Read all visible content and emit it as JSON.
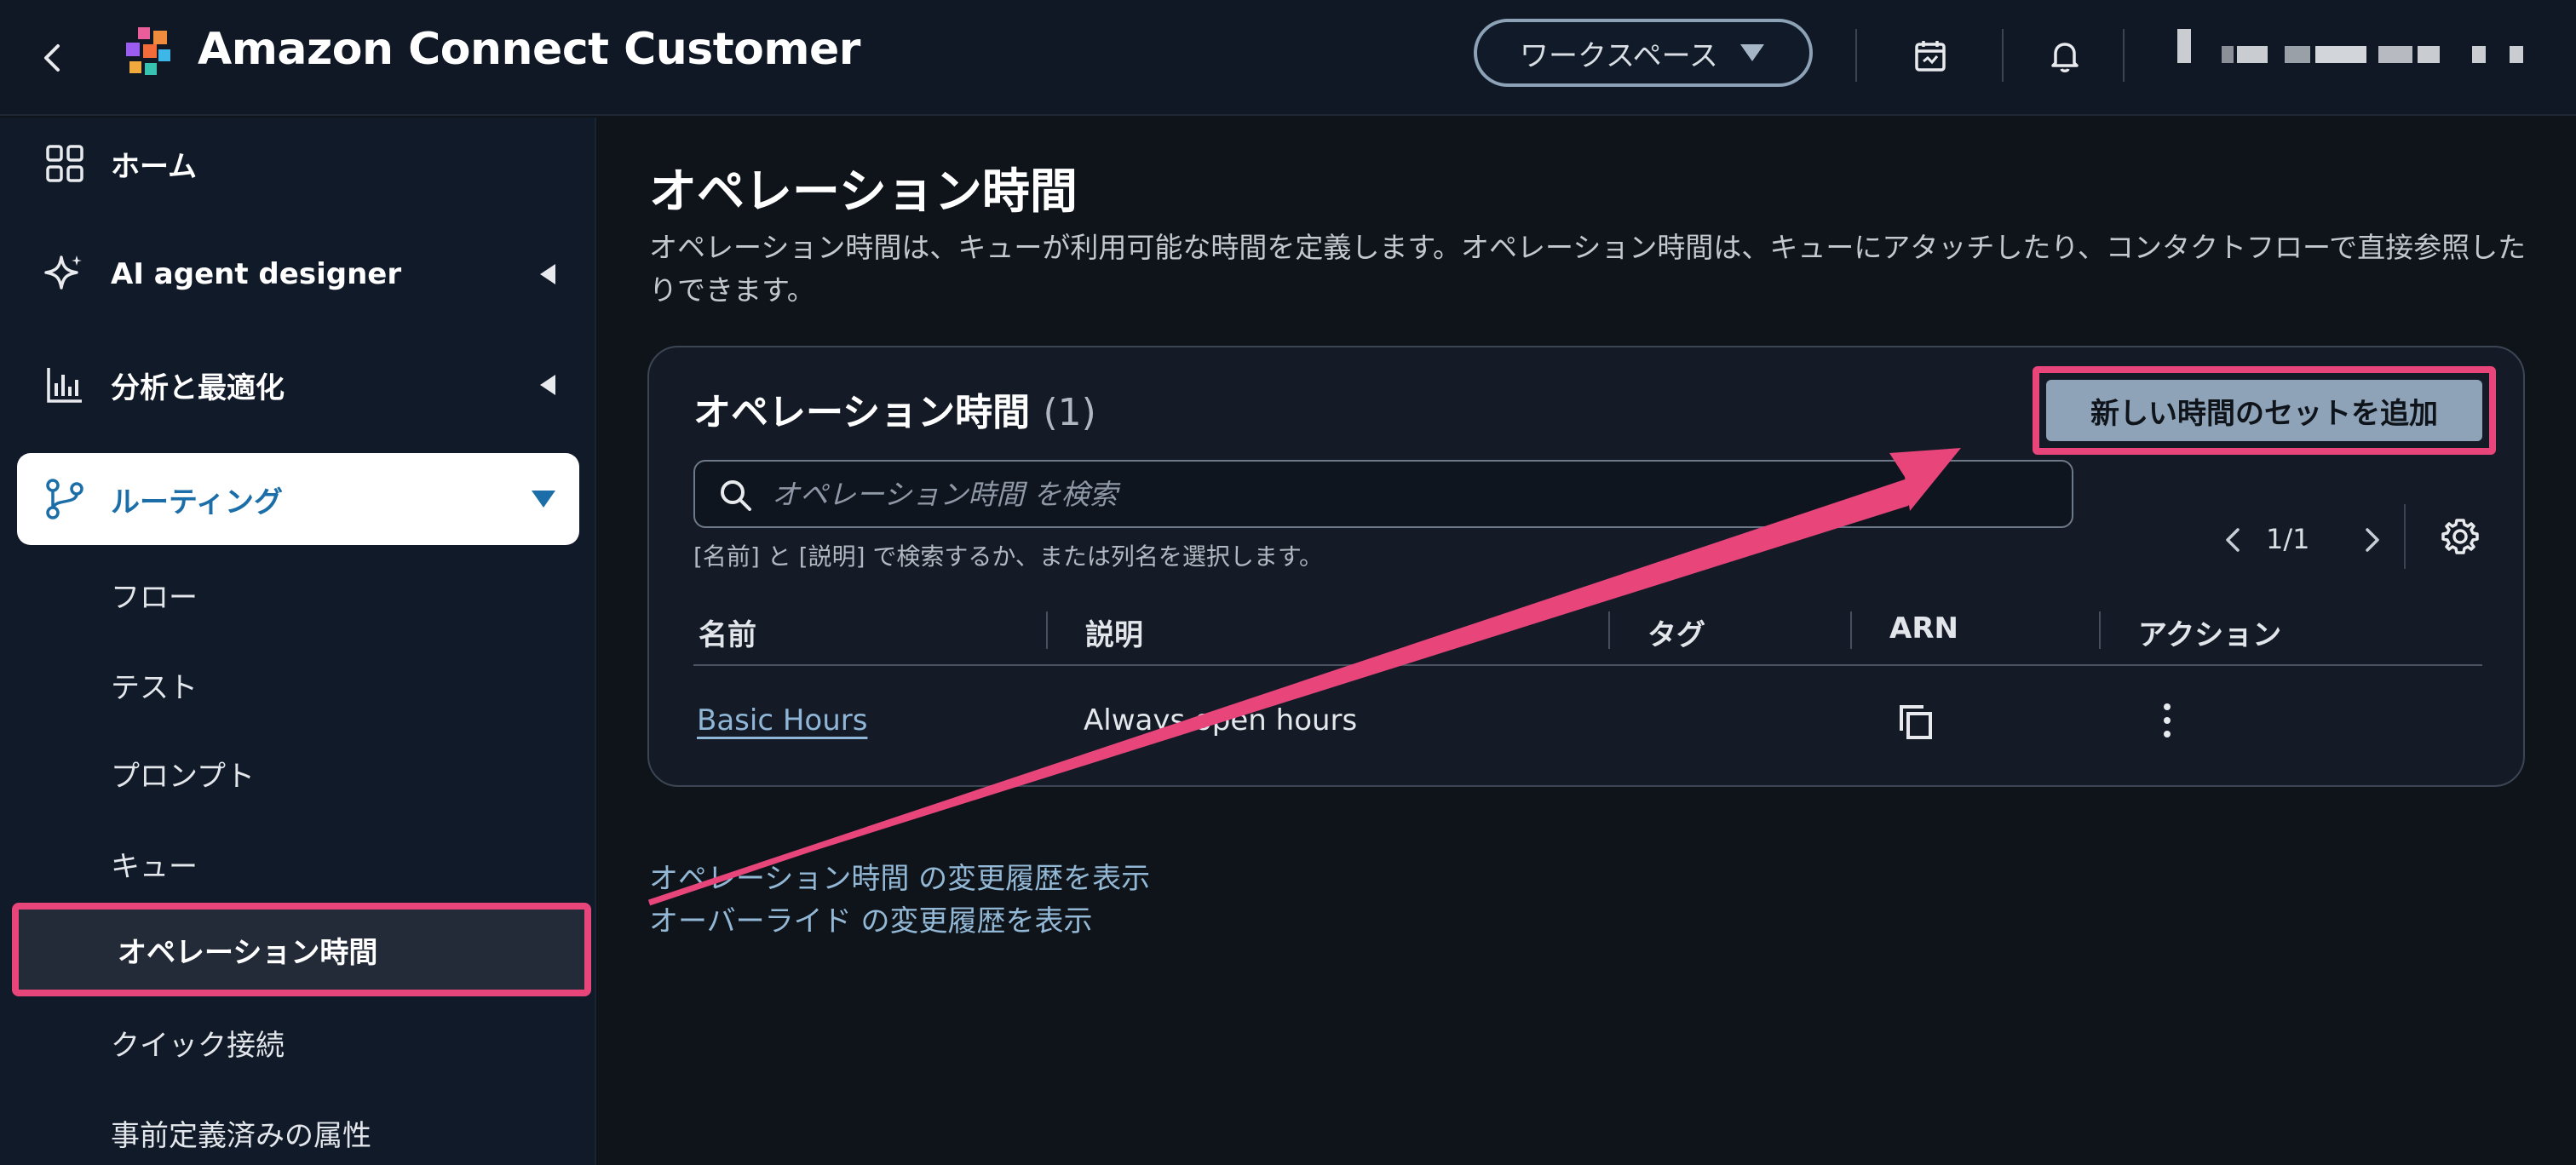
{
  "header": {
    "app_title": "Amazon Connect Customer",
    "workspace_label": "ワークスペース"
  },
  "sidebar": {
    "items": [
      {
        "label": "ホーム",
        "icon": "grid-icon"
      },
      {
        "label": "AI agent designer",
        "icon": "sparkle-icon"
      },
      {
        "label": "分析と最適化",
        "icon": "bar-chart-icon"
      },
      {
        "label": "ルーティング",
        "icon": "routing-icon"
      }
    ],
    "routing_sub": [
      "フロー",
      "テスト",
      "プロンプト",
      "キュー",
      "オペレーション時間",
      "クイック接続",
      "事前定義済みの属性"
    ]
  },
  "main": {
    "title": "オペレーション時間",
    "description": "オペレーション時間は、キューが利用可能な時間を定義します。オペレーション時間は、キューにアタッチしたり、コンタクトフローで直接参照したりできます。",
    "card": {
      "title": "オペレーション時間",
      "count": "(1)",
      "add_button": "新しい時間のセットを追加",
      "search_placeholder": "オペレーション時間 を検索",
      "search_hint": "[名前] と [説明] で検索するか、または列名を選択します。",
      "page_label": "1/1",
      "columns": [
        "名前",
        "説明",
        "タグ",
        "ARN",
        "アクション"
      ],
      "rows": [
        {
          "name": "Basic Hours",
          "description": "Always open hours",
          "tags": ""
        }
      ]
    },
    "history_links": [
      "オペレーション時間 の変更履歴を表示",
      "オーバーライド の変更履歴を表示"
    ]
  },
  "colors": {
    "highlight": "#e8457b",
    "background": "#0f141b",
    "link": "#8fb6d6",
    "primary_button": "#8ea3b7"
  }
}
